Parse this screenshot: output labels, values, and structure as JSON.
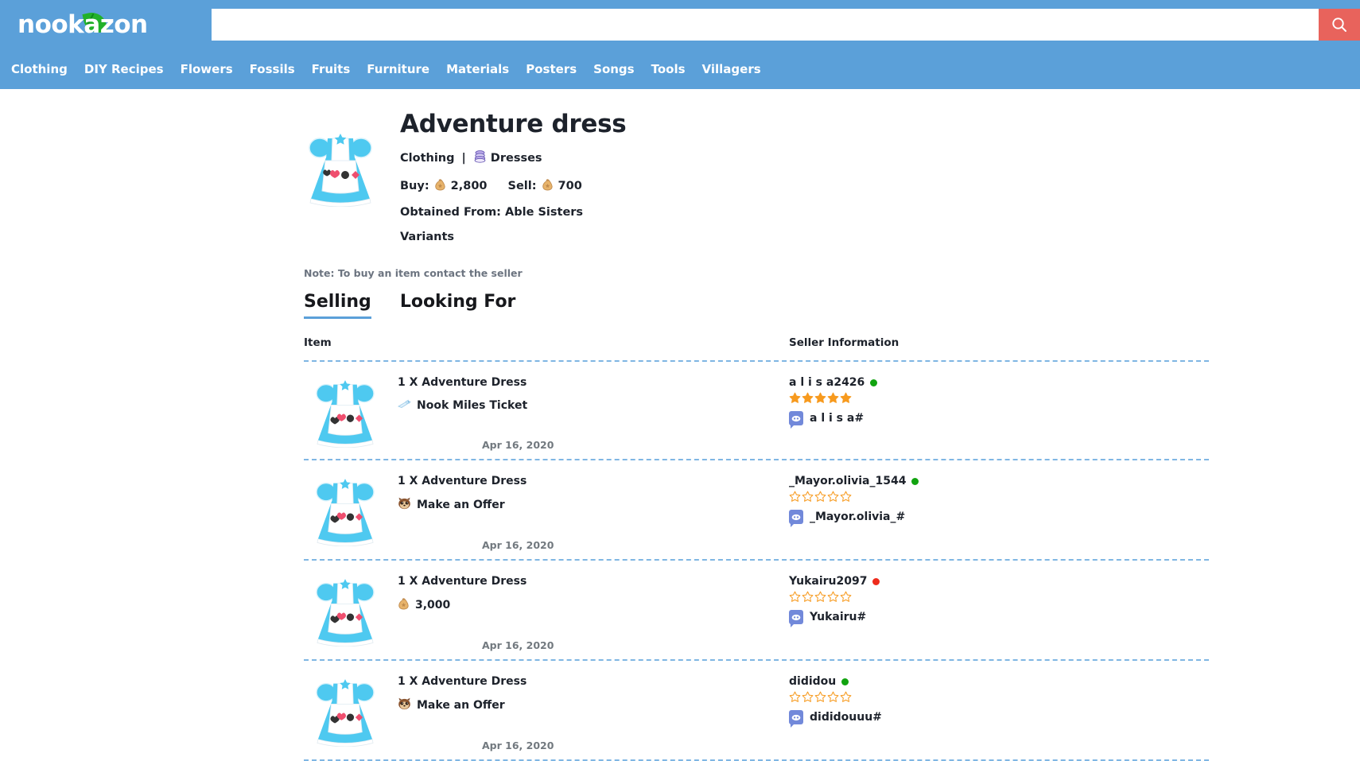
{
  "site": {
    "logo_text": "nookazon",
    "logo_a": "a",
    "logo_pre": "nook",
    "logo_post": "zon"
  },
  "search": {
    "value": "",
    "placeholder": "",
    "button_icon": "search-icon"
  },
  "nav": {
    "items": [
      {
        "label": "Clothing"
      },
      {
        "label": "DIY Recipes"
      },
      {
        "label": "Flowers"
      },
      {
        "label": "Fossils"
      },
      {
        "label": "Fruits"
      },
      {
        "label": "Furniture"
      },
      {
        "label": "Materials"
      },
      {
        "label": "Posters"
      },
      {
        "label": "Songs"
      },
      {
        "label": "Tools"
      },
      {
        "label": "Villagers"
      }
    ]
  },
  "product": {
    "title": "Adventure dress",
    "category": "Clothing",
    "separator": "|",
    "subcategory": "Dresses",
    "subcategory_icon": "dress-stack-icon",
    "buy_label": "Buy:",
    "buy_price": "2,800",
    "sell_label": "Sell:",
    "sell_price": "700",
    "bell_icon": "bell-bag-icon",
    "obtained_from": "Obtained From: Able Sisters",
    "variants_label": "Variants",
    "image_alt": "adventure-dress"
  },
  "note": "Note: To buy an item contact the seller",
  "tabs": [
    {
      "label": "Selling",
      "active": true
    },
    {
      "label": "Looking For",
      "active": false
    }
  ],
  "table": {
    "headers": {
      "item": "Item",
      "seller": "Seller Information"
    },
    "rows": [
      {
        "item_qty": "1 X Adventure Dress",
        "price_text": "Nook Miles Ticket",
        "price_icon": "nook-miles-ticket-icon",
        "date": "Apr 16, 2020",
        "seller_name": "a l i s a2426",
        "status": "online",
        "status_color": "#11a30f",
        "rating": 5,
        "discord": "a l i s a#"
      },
      {
        "item_qty": "1 X Adventure Dress",
        "price_text": "Make an Offer",
        "price_icon": "tom-nook-icon",
        "date": "Apr 16, 2020",
        "seller_name": "_Mayor.olivia_1544",
        "status": "online",
        "status_color": "#11a30f",
        "rating": 0,
        "discord": "_Mayor.olivia_#"
      },
      {
        "item_qty": "1 X Adventure Dress",
        "price_text": "3,000",
        "price_icon": "bell-bag-icon",
        "date": "Apr 16, 2020",
        "seller_name": "Yukairu2097",
        "status": "offline",
        "status_color": "#ee2b1c",
        "rating": 0,
        "discord": "Yukairu#"
      },
      {
        "item_qty": "1 X Adventure Dress",
        "price_text": "Make an Offer",
        "price_icon": "tom-nook-icon",
        "date": "Apr 16, 2020",
        "seller_name": "dididou",
        "status": "online",
        "status_color": "#11a30f",
        "rating": 0,
        "discord": "dididouuu#"
      }
    ]
  },
  "colors": {
    "header_blue": "#5ba0d9",
    "search_red": "#e8635c",
    "leaf_green": "#22b12a",
    "star_orange": "#f79a1e",
    "dashed_blue": "#7fb6e3",
    "discord_blurple": "#7289da"
  }
}
